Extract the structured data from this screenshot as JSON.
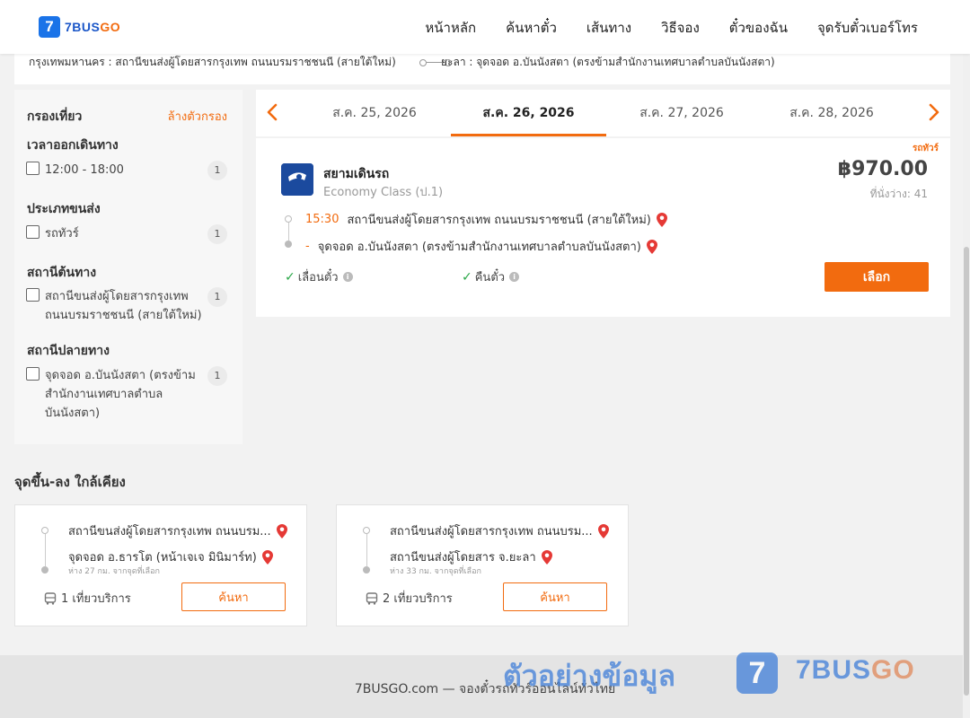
{
  "header": {
    "logo_mark": "7",
    "logo_text_a": "7BUS",
    "logo_text_b": "GO",
    "nav": [
      "หน้าหลัก",
      "ค้นหาตั๋ว",
      "เส้นทาง",
      "วิธีจอง",
      "ตั๋วของฉัน",
      "จุดรับตั๋วเบอร์โทร"
    ]
  },
  "route": {
    "from": "กรุงเทพมหานคร : สถานีขนส่งผู้โดยสารกรุงเทพ ถนนบรมราชชนนี (สายใต้ใหม่)",
    "to": "ยะลา : จุดจอด อ.บันนังสตา (ตรงข้ามสำนักงานเทศบาลตำบลบันนังสตา)"
  },
  "filters": {
    "title": "กรองเที่ยว",
    "clear_label": "ล้างตัวกรอง",
    "groups": [
      {
        "heading": "เวลาออกเดินทาง",
        "option": "12:00 - 18:00",
        "count": "1"
      },
      {
        "heading": "ประเภทขนส่ง",
        "option": "รถทัวร์",
        "count": "1"
      },
      {
        "heading": "สถานีต้นทาง",
        "option": "สถานีขนส่งผู้โดยสารกรุงเทพ ถนนบรมราชชนนี (สายใต้ใหม่)",
        "count": "1"
      },
      {
        "heading": "สถานีปลายทาง",
        "option": "จุดจอด อ.บันนังสตา (ตรงข้ามสำนักงานเทศบาลตำบลบันนังสตา)",
        "count": "1"
      }
    ]
  },
  "dates": {
    "tabs": [
      "ส.ค. 25, 2026",
      "ส.ค. 26, 2026",
      "ส.ค. 27, 2026",
      "ส.ค. 28, 2026"
    ],
    "active_index": 1
  },
  "trip": {
    "tag": "รถทัวร์",
    "operator": "สยามเดินรถ",
    "operator_logo_text": "สยามเดินรถ",
    "class": "Economy Class (ป.1)",
    "price": "฿970.00",
    "seats": "ที่นั่งว่าง: 41",
    "depart_time": "15:30",
    "depart_station": "สถานีขนส่งผู้โดยสารกรุงเทพ ถนนบรมราชชนนี (สายใต้ใหม่)",
    "arrive_time": "-",
    "arrive_station": "จุดจอด อ.บันนังสตา (ตรงข้ามสำนักงานเทศบาลตำบลบันนังสตา)",
    "feature_1": "เลื่อนตั๋ว",
    "feature_2": "คืนตั๋ว",
    "info_glyph": "i",
    "select_label": "เลือก"
  },
  "nearby": {
    "title": "จุดขึ้น-ลง ใกล้เคียง",
    "cards": [
      {
        "from": "สถานีขนส่งผู้โดยสารกรุงเทพ ถนนบรม...",
        "to": "จุดจอด อ.ธารโต (หน้าเจเจ มินิมาร์ท)",
        "distance": "ห่าง 27 กม. จากจุดที่เลือก",
        "trips": "1 เที่ยวบริการ",
        "button": "ค้นหา"
      },
      {
        "from": "สถานีขนส่งผู้โดยสารกรุงเทพ ถนนบรม...",
        "to": "สถานีขนส่งผู้โดยสาร จ.ยะลา",
        "distance": "ห่าง 33 กม. จากจุดที่เลือก",
        "trips": "2 เที่ยวบริการ",
        "button": "ค้นหา"
      }
    ]
  },
  "footer": {
    "text": "7BUSGO.com — จองตั๋วรถทัวร์ออนไลน์ทั่วไทย"
  },
  "watermark": {
    "text": "ตัวอย่างข้อมูล",
    "mark": "7",
    "brand_a": "7BUS",
    "brand_b": "GO"
  },
  "colors": {
    "accent": "#f26b0f",
    "brand": "#1a56c8",
    "check": "#2aa748",
    "pin": "#e53935"
  }
}
